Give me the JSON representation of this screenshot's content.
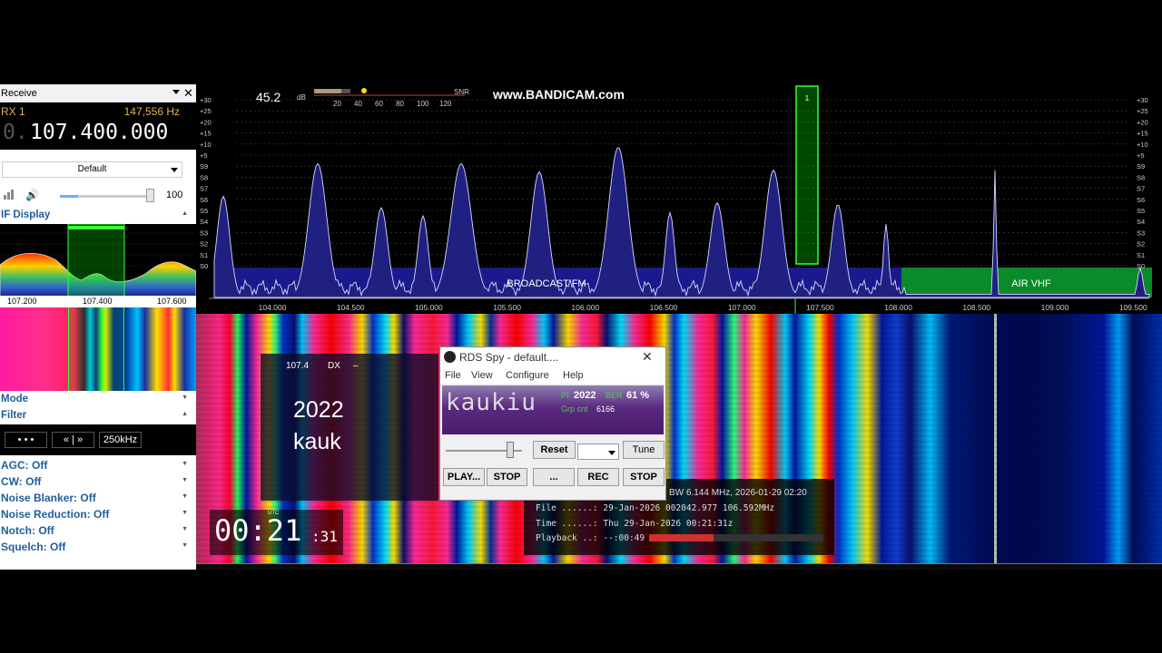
{
  "receive_panel": {
    "title": "Receive",
    "rx_label": "RX 1",
    "offset_hz": "147,556 Hz",
    "freq_prefix": "0.",
    "frequency": "107.400.000",
    "preset": "Default",
    "volume": "100"
  },
  "if_display": {
    "label": "IF Display",
    "scale": [
      "107.200",
      "107.400",
      "107.600"
    ]
  },
  "mode_label": "Mode",
  "filter": {
    "label": "Filter",
    "btn_dots": "• • •",
    "btn_arrows": "« | »",
    "bandwidth": "250kHz"
  },
  "options": [
    "AGC: Off",
    "CW: Off",
    "Noise Blanker: Off",
    "Noise Reduction: Off",
    "Notch: Off",
    "Squelch: Off"
  ],
  "spectrum": {
    "snr_value": "45.2",
    "snr_unit": "dB",
    "snr_label": "SNR",
    "snr_scale": [
      "20",
      "40",
      "60",
      "80",
      "100",
      "120"
    ],
    "watermark": "www.BANDICAM.com",
    "marker_label": "1",
    "db_scale": [
      "+30",
      "+25",
      "+20",
      "+15",
      "+10",
      "+5",
      "S9",
      "S8",
      "S7",
      "S6",
      "S5",
      "S4",
      "S3",
      "S2",
      "S1",
      "S0"
    ],
    "freq_axis": [
      "104.000",
      "104.500",
      "105.000",
      "105.500",
      "106.000",
      "106.500",
      "107.000",
      "107.500",
      "108.000",
      "108.500",
      "109.000",
      "109.500"
    ],
    "band_broadcast": "BROADCAST FM",
    "band_air": "AIR VHF",
    "colors": {
      "band_broadcast": "#1a1a8c",
      "band_air": "#0a8a2a",
      "marker": "#36ff36"
    }
  },
  "overlay_station": {
    "freq": "107.4",
    "tag": "DX",
    "dash": "–",
    "pi": "2022",
    "ps": "kauk"
  },
  "clock": {
    "utc_label": "UTC",
    "hhmm": "00:21",
    "seconds": ":31"
  },
  "recording_info": {
    "line1": "BW 6.144 MHz, 2026-01-29 02:20",
    "line2": "File ......: 29-Jan-2026 002042.977 106.592MHz",
    "line3": "Time ......: Thu 29-Jan-2026 00:21:31z",
    "line4": "Playback ..: --:00:49",
    "progress": 0.37
  },
  "rds_spy": {
    "title": "RDS Spy - default....",
    "close": "✕",
    "menu": [
      "File",
      "View",
      "Configure",
      "Help"
    ],
    "ps": "kaukiu",
    "pi_label": "PI",
    "pi_value": "2022",
    "ber_label": "BER",
    "ber_value": "61 %",
    "grp_label": "Grp cnt",
    "grp_value": "6166",
    "buttons": {
      "reset": "Reset",
      "tune": "Tune",
      "play": "PLAY...",
      "stop1": "STOP",
      "dots": "...",
      "rec": "REC",
      "stop2": "STOP"
    }
  }
}
